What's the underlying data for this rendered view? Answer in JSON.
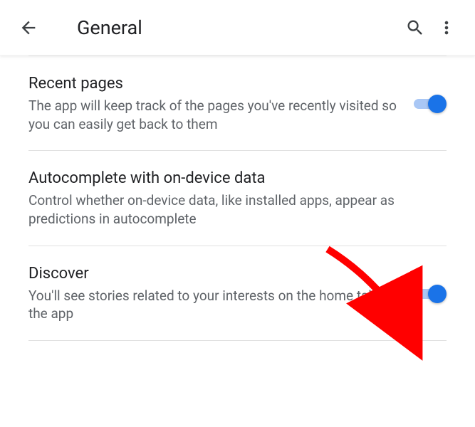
{
  "header": {
    "title": "General"
  },
  "settings": {
    "recentPages": {
      "title": "Recent pages",
      "description": "The app will keep track of the pages you've recently visited so you can easily get back to them",
      "enabled": true
    },
    "autocomplete": {
      "title": "Autocomplete with on-device data",
      "description": "Control whether on-device data, like installed apps, appear as predictions in autocomplete"
    },
    "discover": {
      "title": "Discover",
      "description": "You'll see stories related to your interests on the home tab of the app",
      "enabled": true
    }
  },
  "annotation": {
    "arrowColor": "#ff0000",
    "target": "discover-toggle"
  }
}
